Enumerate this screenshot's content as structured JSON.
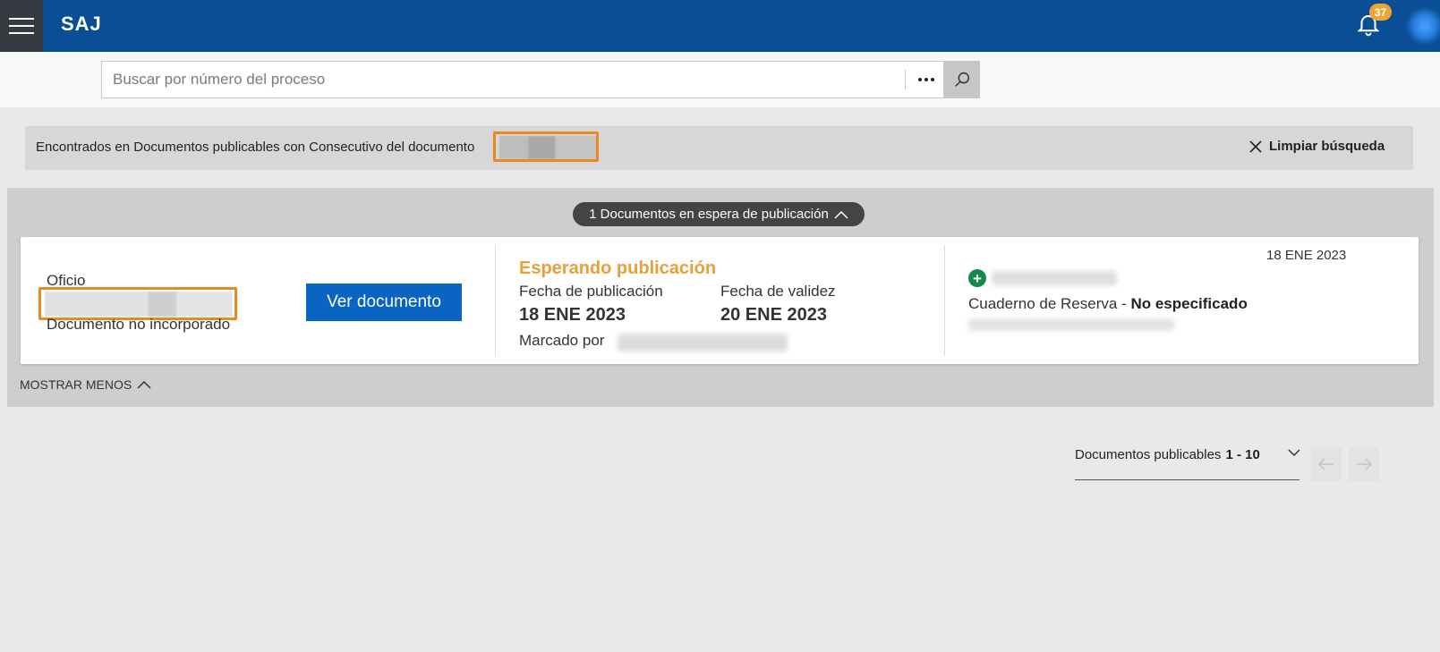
{
  "header": {
    "brand": "SAJ",
    "notification_count": "37"
  },
  "search": {
    "placeholder": "Buscar por número del proceso",
    "value": ""
  },
  "found_bar": {
    "text": "Encontrados en Documentos publicables con Consecutivo del documento",
    "clear_label": "Limpiar búsqueda"
  },
  "results": {
    "pending_label": "1 Documentos en espera de publicación",
    "show_less_label": "MOSTRAR MENOS",
    "card": {
      "doc_type": "Oficio",
      "doc_status": "Documento no incorporado",
      "view_button": "Ver documento",
      "status_title": "Esperando publicación",
      "pub_date_label": "Fecha de publicación",
      "pub_date_value": "18 ENE 2023",
      "validity_label": "Fecha de validez",
      "validity_value": "20 ENE 2023",
      "marked_by_label": "Marcado por",
      "date": "18 ENE 2023",
      "cuaderno_label": "Cuaderno de Reserva -",
      "cuaderno_value": "No especificado"
    }
  },
  "pagination": {
    "label": "Documentos publicables",
    "range": "1 - 10"
  },
  "colors": {
    "topbar": "#0a4f95",
    "accent_orange": "#e9a03a",
    "highlight_orange": "#e98a1f",
    "primary_button": "#0a64c2",
    "add_green": "#138a4b"
  }
}
